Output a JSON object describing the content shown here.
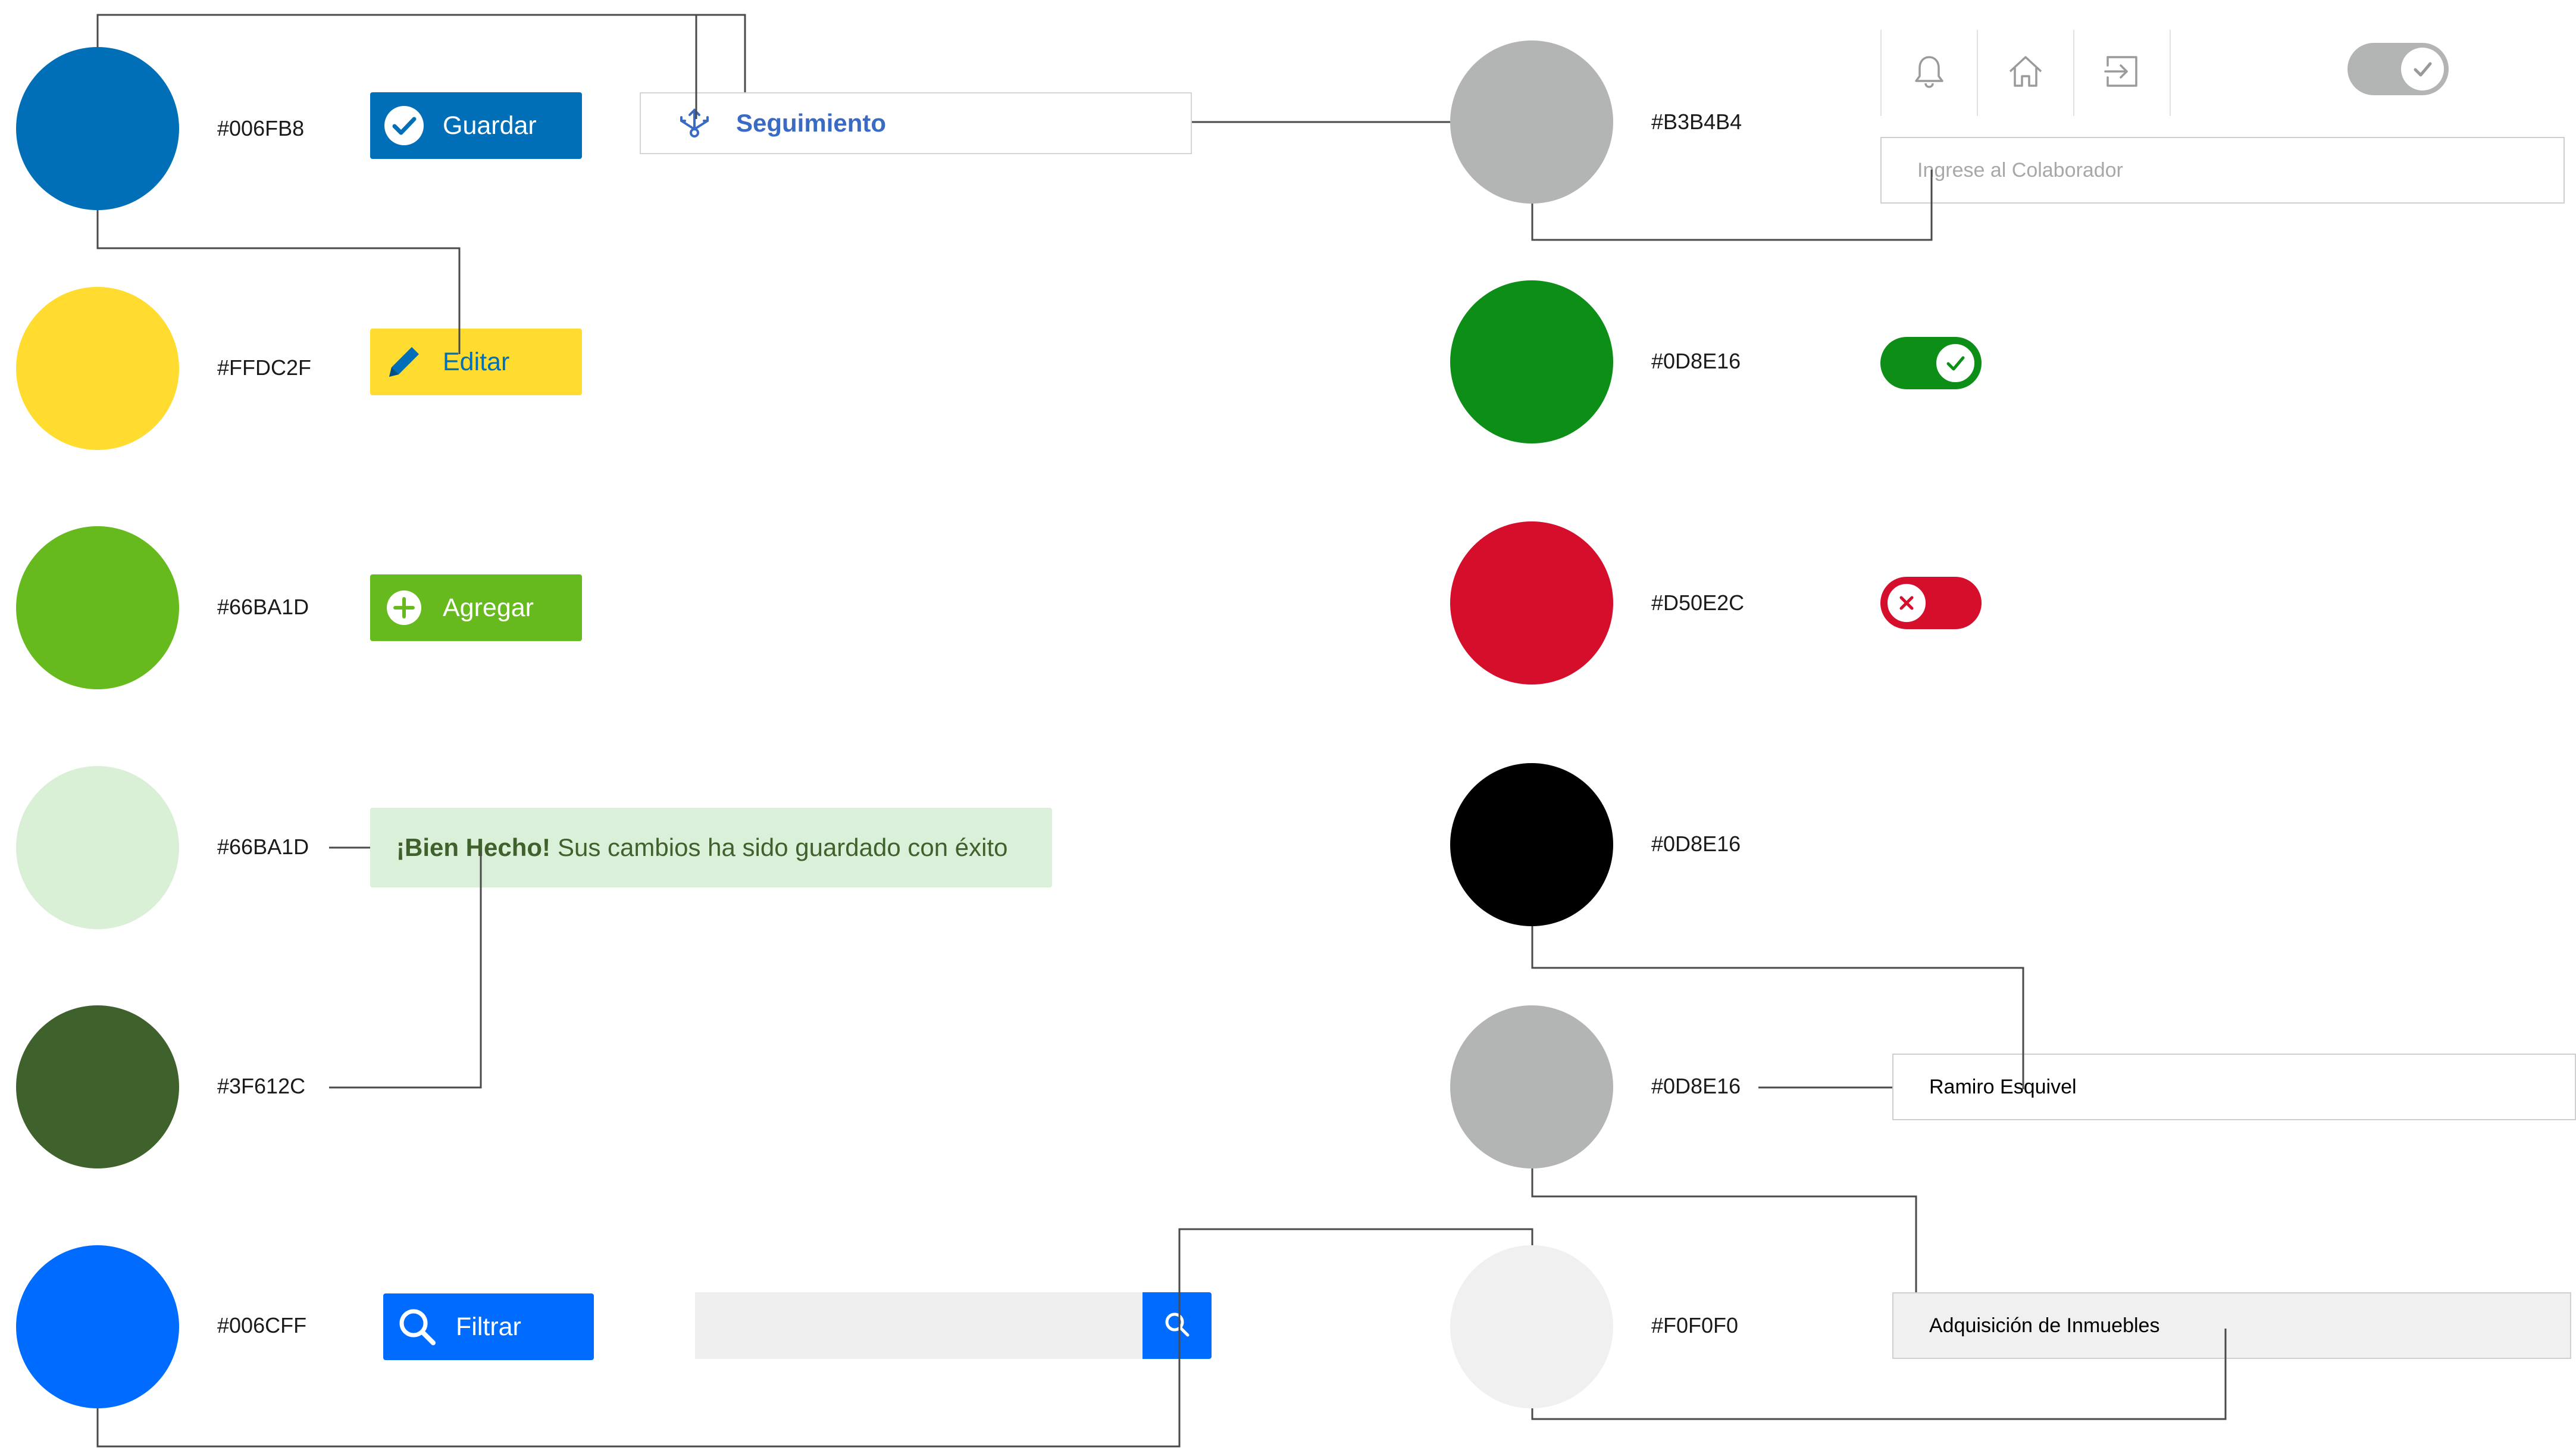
{
  "palette": {
    "left": [
      {
        "hex": "#006FB8",
        "color": "#006FB8"
      },
      {
        "hex": "#FFDC2F",
        "color": "#FFDC2F"
      },
      {
        "hex": "#66BA1D",
        "color": "#66BA1D"
      },
      {
        "hex": "#66BA1D",
        "color": "#D9F0D6"
      },
      {
        "hex": "#3F612C",
        "color": "#3F612C"
      },
      {
        "hex": "#006CFF",
        "color": "#006CFF"
      }
    ],
    "right": [
      {
        "hex": "#B3B4B4",
        "color": "#B3B4B4"
      },
      {
        "hex": "#0D8E16",
        "color": "#0D8E16"
      },
      {
        "hex": "#D50E2C",
        "color": "#D50E2C"
      },
      {
        "hex": "#0D8E16",
        "color": "#000000"
      },
      {
        "hex": "#0D8E16",
        "color": "#B3B4B4"
      },
      {
        "hex": "#F0F0F0",
        "color": "#F0F0F0"
      }
    ]
  },
  "buttons": {
    "guardar": {
      "label": "Guardar",
      "bg": "#006FB8",
      "fg": "#ffffff",
      "icon": "check-circle-icon"
    },
    "editar": {
      "label": "Editar",
      "bg": "#FFDC2F",
      "fg": "#006FB8",
      "icon": "pencil-icon"
    },
    "agregar": {
      "label": "Agregar",
      "bg": "#66BA1D",
      "fg": "#ffffff",
      "icon": "plus-circle-icon"
    },
    "filtrar": {
      "label": "Filtrar",
      "bg": "#006CFF",
      "fg": "#ffffff",
      "icon": "search-icon"
    }
  },
  "tab": {
    "label": "Seguimiento",
    "icon": "branch-icon"
  },
  "alert": {
    "title": "¡Bien Hecho!",
    "message": "Sus cambios ha sido guardado con éxito"
  },
  "search": {
    "value": "",
    "icon": "search-icon"
  },
  "header_icons": [
    "bell-icon",
    "home-icon",
    "logout-icon"
  ],
  "toggles": {
    "neutral": {
      "state": "on",
      "color": "#B3B4B4",
      "icon": "check-icon"
    },
    "success": {
      "state": "on",
      "color": "#0D8E16",
      "icon": "check-icon"
    },
    "error": {
      "state": "off",
      "color": "#D50E2C",
      "icon": "x-icon"
    }
  },
  "colaborador_input": {
    "placeholder": "Ingrese al Colaborador",
    "value": ""
  },
  "name_input": {
    "value": "Ramiro Esquivel"
  },
  "select_input": {
    "value": "Adquisición de Inmuebles"
  }
}
